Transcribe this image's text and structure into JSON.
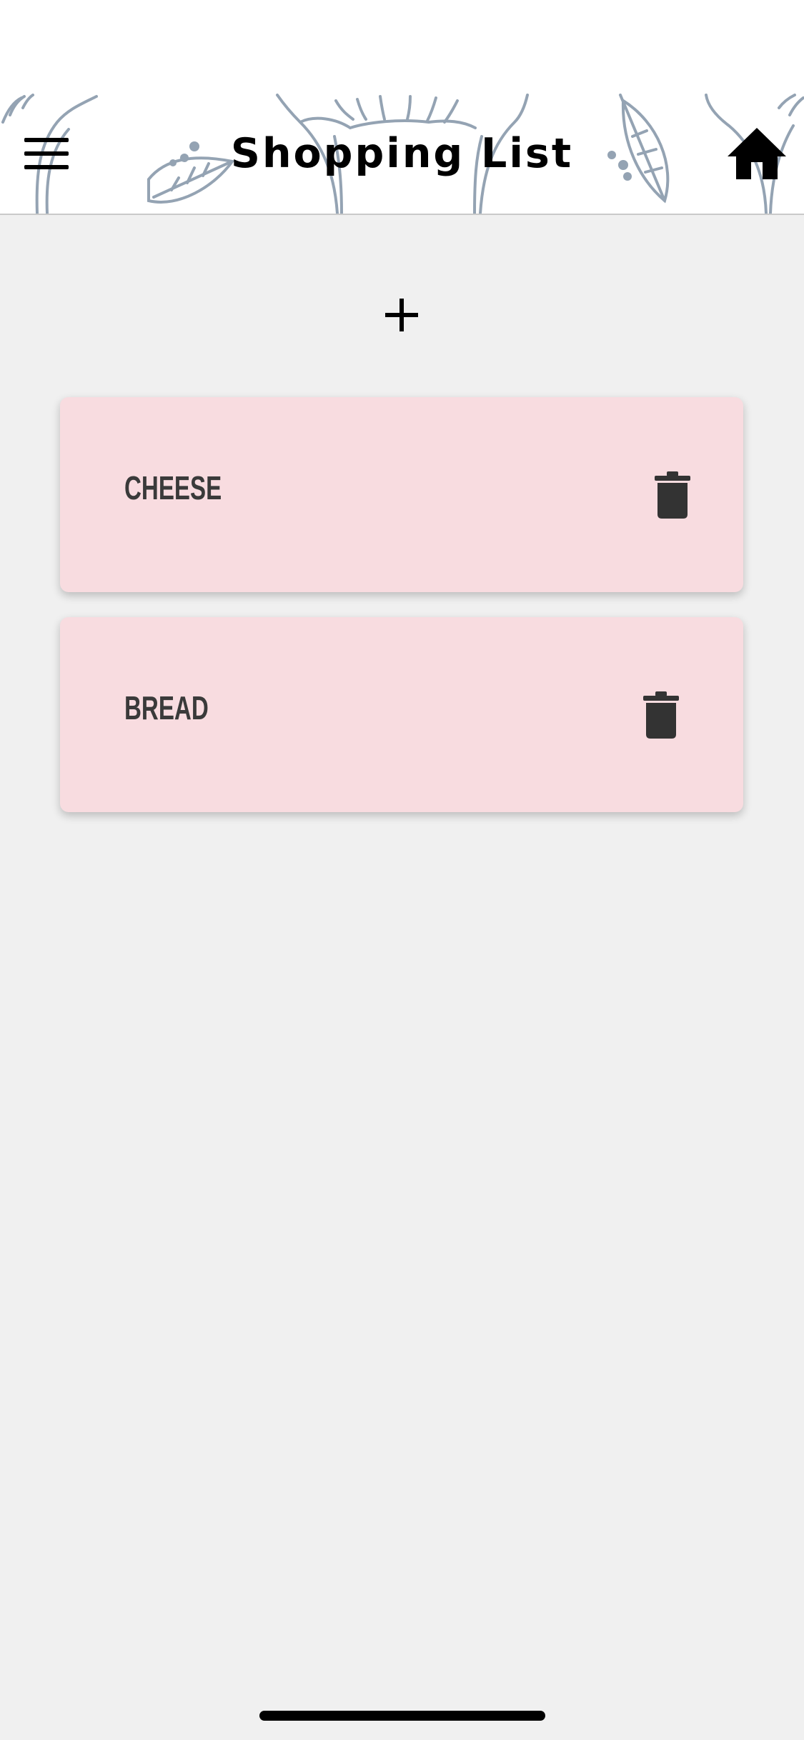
{
  "header": {
    "title": "Shopping List",
    "menu_icon": "hamburger-menu-icon",
    "home_icon": "home-icon"
  },
  "toolbar": {
    "add_icon": "plus-icon"
  },
  "list": {
    "items": [
      {
        "label": "CHEESE",
        "delete_icon": "trash-icon"
      },
      {
        "label": "BREAD",
        "delete_icon": "trash-icon"
      }
    ]
  },
  "colors": {
    "background": "#f0f0f0",
    "header_background": "#ffffff",
    "card_background": "#f8dce0",
    "item_text": "#3a3a3a",
    "trash_icon": "#333333",
    "decor_line": "#94a3b3"
  }
}
